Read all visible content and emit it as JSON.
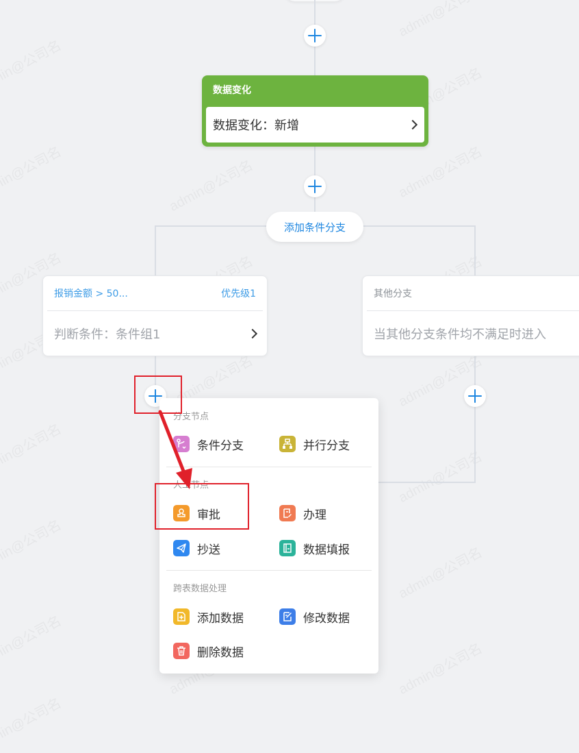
{
  "watermark": "admin@公司名",
  "trigger": {
    "title": "数据变化",
    "body": "数据变化：新增"
  },
  "add_branch_label": "添加条件分支",
  "branch_left": {
    "name": "报销金额 > 50...",
    "priority": "优先级1",
    "condition": "判断条件：条件组1"
  },
  "branch_right": {
    "name": "其他分支",
    "condition": "当其他分支条件均不满足时进入"
  },
  "menu": {
    "section1": "分支节点",
    "item_condition_branch": "条件分支",
    "item_parallel_branch": "并行分支",
    "section2": "人工节点",
    "item_approve": "审批",
    "item_handle": "办理",
    "item_cc": "抄送",
    "item_data_fill": "数据填报",
    "section3": "跨表数据处理",
    "item_add_data": "添加数据",
    "item_edit_data": "修改数据",
    "item_delete_data": "删除数据"
  },
  "colors": {
    "trigger_green": "#6db33f",
    "accent_blue": "#1d86e0",
    "highlight_red": "#e0202a"
  }
}
